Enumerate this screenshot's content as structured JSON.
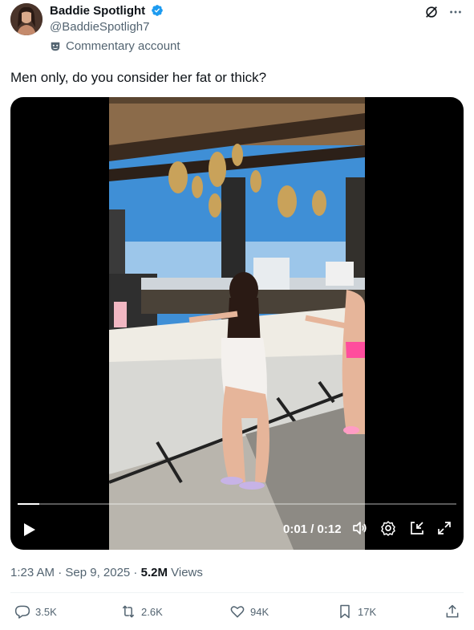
{
  "author": {
    "display_name": "Baddie Spotlight",
    "handle": "@BaddieSpotligh7",
    "account_label": "Commentary account",
    "verified": true
  },
  "tweet": {
    "text": "Men only, do you consider her fat or thick?"
  },
  "video": {
    "time": "0:01 / 0:12",
    "progress": 0.05
  },
  "meta": {
    "timestamp": "1:23 AM · Sep 9, 2025 · ",
    "views_count": "5.2M",
    "views_label": " Views"
  },
  "actions": {
    "replies": "3.5K",
    "reposts": "2.6K",
    "likes": "94K",
    "bookmarks": "17K"
  },
  "colors": {
    "verified_blue": "#1d9bf0",
    "secondary_text": "#536471"
  }
}
